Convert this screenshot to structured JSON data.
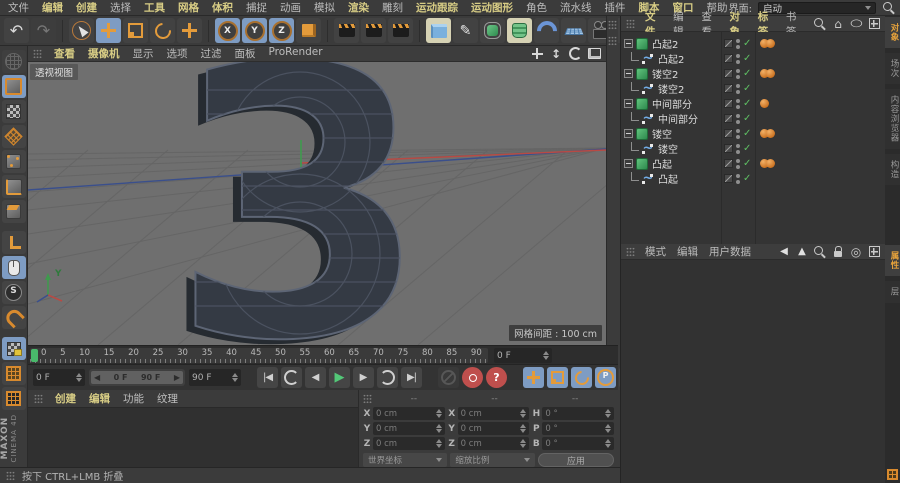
{
  "menubar": {
    "items": [
      {
        "label": "文件",
        "accent": false
      },
      {
        "label": "编辑",
        "accent": true
      },
      {
        "label": "创建",
        "accent": true
      },
      {
        "label": "选择",
        "accent": false
      },
      {
        "label": "工具",
        "accent": true
      },
      {
        "label": "网格",
        "accent": true
      },
      {
        "label": "体积",
        "accent": true
      },
      {
        "label": "捕捉",
        "accent": false
      },
      {
        "label": "动画",
        "accent": false
      },
      {
        "label": "模拟",
        "accent": false
      },
      {
        "label": "渲染",
        "accent": true
      },
      {
        "label": "雕刻",
        "accent": false
      },
      {
        "label": "运动跟踪",
        "accent": true
      },
      {
        "label": "运动图形",
        "accent": true
      },
      {
        "label": "角色",
        "accent": false
      },
      {
        "label": "流水线",
        "accent": false
      },
      {
        "label": "插件",
        "accent": false
      },
      {
        "label": "脚本",
        "accent": true
      },
      {
        "label": "窗口",
        "accent": true
      },
      {
        "label": "帮助",
        "accent": false
      }
    ],
    "interface": {
      "label": "界面:",
      "value": "启动"
    }
  },
  "toolbar": {
    "icons": [
      {
        "name": "undo"
      },
      {
        "name": "redo",
        "state": "disabled"
      },
      {
        "name": "sep"
      },
      {
        "name": "cursor"
      },
      {
        "name": "move",
        "state": "active"
      },
      {
        "name": "scale"
      },
      {
        "name": "rotate"
      },
      {
        "name": "move-axis"
      },
      {
        "name": "sep"
      },
      {
        "name": "axis-x",
        "state": "active"
      },
      {
        "name": "axis-y",
        "state": "active"
      },
      {
        "name": "axis-z",
        "state": "active"
      },
      {
        "name": "coord-system"
      },
      {
        "name": "sep"
      },
      {
        "name": "render-view"
      },
      {
        "name": "render-picture-viewer"
      },
      {
        "name": "render-settings"
      },
      {
        "name": "sep"
      },
      {
        "name": "add-cube",
        "state": "pressed"
      },
      {
        "name": "draw-spline"
      },
      {
        "name": "subdivision-surface"
      },
      {
        "name": "generator-extrude",
        "state": "pressed"
      },
      {
        "name": "bend-deformer"
      },
      {
        "name": "floor-object"
      },
      {
        "name": "camera-object"
      },
      {
        "name": "light-object"
      }
    ]
  },
  "left_toolbar": {
    "icons": [
      {
        "name": "make-editable",
        "state": "disabled"
      },
      {
        "name": "model-mode",
        "state": "active"
      },
      {
        "name": "texture-mode"
      },
      {
        "name": "workplane-mode"
      },
      {
        "name": "points-mode"
      },
      {
        "name": "edges-mode"
      },
      {
        "name": "polygons-mode"
      },
      {
        "name": "gap"
      },
      {
        "name": "enable-axis"
      },
      {
        "name": "viewport-solo",
        "state": "active"
      },
      {
        "name": "snap-auto"
      },
      {
        "name": "snap-magnet"
      },
      {
        "name": "gap"
      },
      {
        "name": "workplane-lock",
        "state": "active"
      },
      {
        "name": "workplane-quantize"
      },
      {
        "name": "texture-view"
      }
    ]
  },
  "brand": {
    "line1": "MAXON",
    "line2": "CINEMA 4D"
  },
  "viewport": {
    "menu": [
      {
        "label": "查看",
        "accent": true
      },
      {
        "label": "摄像机",
        "accent": true
      },
      {
        "label": "显示",
        "accent": false
      },
      {
        "label": "选项",
        "accent": false
      },
      {
        "label": "过滤",
        "accent": false
      },
      {
        "label": "面板",
        "accent": false
      },
      {
        "label": "ProRender",
        "accent": false
      }
    ],
    "corner_icons": [
      {
        "name": "pan-view"
      },
      {
        "name": "dolly-view"
      },
      {
        "name": "rotate-view"
      },
      {
        "name": "toggle-panel"
      }
    ],
    "view_label": "透视视图",
    "grid_label": "网格间距 : 100 cm",
    "axis_y_label": "Y",
    "model_glyph": "3"
  },
  "timeline": {
    "ticks": [
      "0",
      "5",
      "10",
      "15",
      "20",
      "25",
      "30",
      "35",
      "40",
      "45",
      "50",
      "55",
      "60",
      "65",
      "70",
      "75",
      "80",
      "85",
      "90"
    ],
    "current_frame": "0 F",
    "start_frame": "0 F",
    "end_frame": "90 F",
    "range_start": "0 F",
    "range_end": "90 F",
    "range_arrow_left": "◀",
    "range_arrow_right": "▶"
  },
  "transport": {
    "buttons": [
      {
        "name": "goto-start"
      },
      {
        "name": "play-reverse"
      },
      {
        "name": "prev-frame"
      },
      {
        "name": "play"
      },
      {
        "name": "next-frame"
      },
      {
        "name": "loop-mode"
      },
      {
        "name": "goto-end"
      }
    ],
    "record_buttons": [
      {
        "name": "record",
        "state": "disabled"
      },
      {
        "name": "keyframe",
        "state": "red"
      },
      {
        "name": "autokey",
        "state": "red"
      }
    ],
    "key_toggles": [
      {
        "name": "key-position",
        "state": "active"
      },
      {
        "name": "key-scale",
        "state": "active"
      },
      {
        "name": "key-rotation",
        "state": "active"
      },
      {
        "name": "key-parameter",
        "state": "active"
      },
      {
        "name": "key-pla"
      },
      {
        "name": "filmstrip"
      }
    ]
  },
  "materials": {
    "tabs": [
      {
        "label": "创建",
        "accent": true
      },
      {
        "label": "编辑",
        "accent": true
      },
      {
        "label": "功能",
        "accent": false
      },
      {
        "label": "纹理",
        "accent": false
      }
    ]
  },
  "coordinates": {
    "headers": [
      "--",
      "--",
      "--"
    ],
    "rows": [
      {
        "c1": "X",
        "v1": "0 cm",
        "c2": "X",
        "v2": "0 cm",
        "c3": "H",
        "v3": "0 °"
      },
      {
        "c1": "Y",
        "v1": "0 cm",
        "c2": "Y",
        "v2": "0 cm",
        "c3": "P",
        "v3": "0 °"
      },
      {
        "c1": "Z",
        "v1": "0 cm",
        "c2": "Z",
        "v2": "0 cm",
        "c3": "B",
        "v3": "0 °"
      }
    ],
    "dropdown_left": "世界坐标",
    "dropdown_right": "缩放比例",
    "apply_label": "应用"
  },
  "status_bar": {
    "text": "按下 CTRL+LMB 折叠"
  },
  "object_manager": {
    "menu": [
      {
        "label": "文件",
        "accent": true
      },
      {
        "label": "编辑",
        "accent": false
      },
      {
        "label": "查看",
        "accent": false
      },
      {
        "label": "对象",
        "accent": true
      },
      {
        "label": "标签",
        "accent": true
      },
      {
        "label": "书签",
        "accent": false
      }
    ],
    "icons": [
      {
        "name": "search"
      },
      {
        "name": "home"
      },
      {
        "name": "filter"
      },
      {
        "name": "add"
      }
    ],
    "rows": [
      {
        "label": "凸起2",
        "kind": "extrude",
        "tags": 2
      },
      {
        "label": "凸起2",
        "kind": "spline",
        "tags": 0
      },
      {
        "label": "镂空2",
        "kind": "extrude",
        "tags": 2
      },
      {
        "label": "镂空2",
        "kind": "spline",
        "tags": 0
      },
      {
        "label": "中间部分",
        "kind": "extrude",
        "tags": 1
      },
      {
        "label": "中间部分",
        "kind": "spline",
        "tags": 0
      },
      {
        "label": "镂空",
        "kind": "extrude",
        "tags": 2
      },
      {
        "label": "镂空",
        "kind": "spline",
        "tags": 0
      },
      {
        "label": "凸起",
        "kind": "extrude",
        "tags": 2
      },
      {
        "label": "凸起",
        "kind": "spline",
        "tags": 0
      }
    ],
    "side_tabs": [
      {
        "label": "对象",
        "active": true
      },
      {
        "label": "场次",
        "active": false
      },
      {
        "label": "内容浏览器",
        "active": false
      },
      {
        "label": "构造",
        "active": false
      }
    ]
  },
  "attribute_manager": {
    "menu": [
      {
        "label": "模式",
        "accent": false
      },
      {
        "label": "编辑",
        "accent": false
      },
      {
        "label": "用户数据",
        "accent": false
      }
    ],
    "icons": [
      {
        "name": "back"
      },
      {
        "name": "forward"
      },
      {
        "name": "search"
      },
      {
        "name": "lock"
      },
      {
        "name": "target"
      },
      {
        "name": "add"
      }
    ],
    "side_tabs": [
      {
        "label": "属性",
        "active": true
      },
      {
        "label": "层",
        "active": false
      }
    ]
  },
  "colors": {
    "accent_orange": "#e39b3b",
    "accent_yellow": "#d8cd85",
    "highlight_blue": "#7e9cc3",
    "viewport_grey": "#6f6f6f",
    "axis_red": "#b84a44",
    "axis_green": "#3f9a4d",
    "axis_blue": "#3a4f8c",
    "playhead_green": "#49b96b",
    "tag_orange": "#d9822b",
    "check_green": "#5fbf63"
  }
}
